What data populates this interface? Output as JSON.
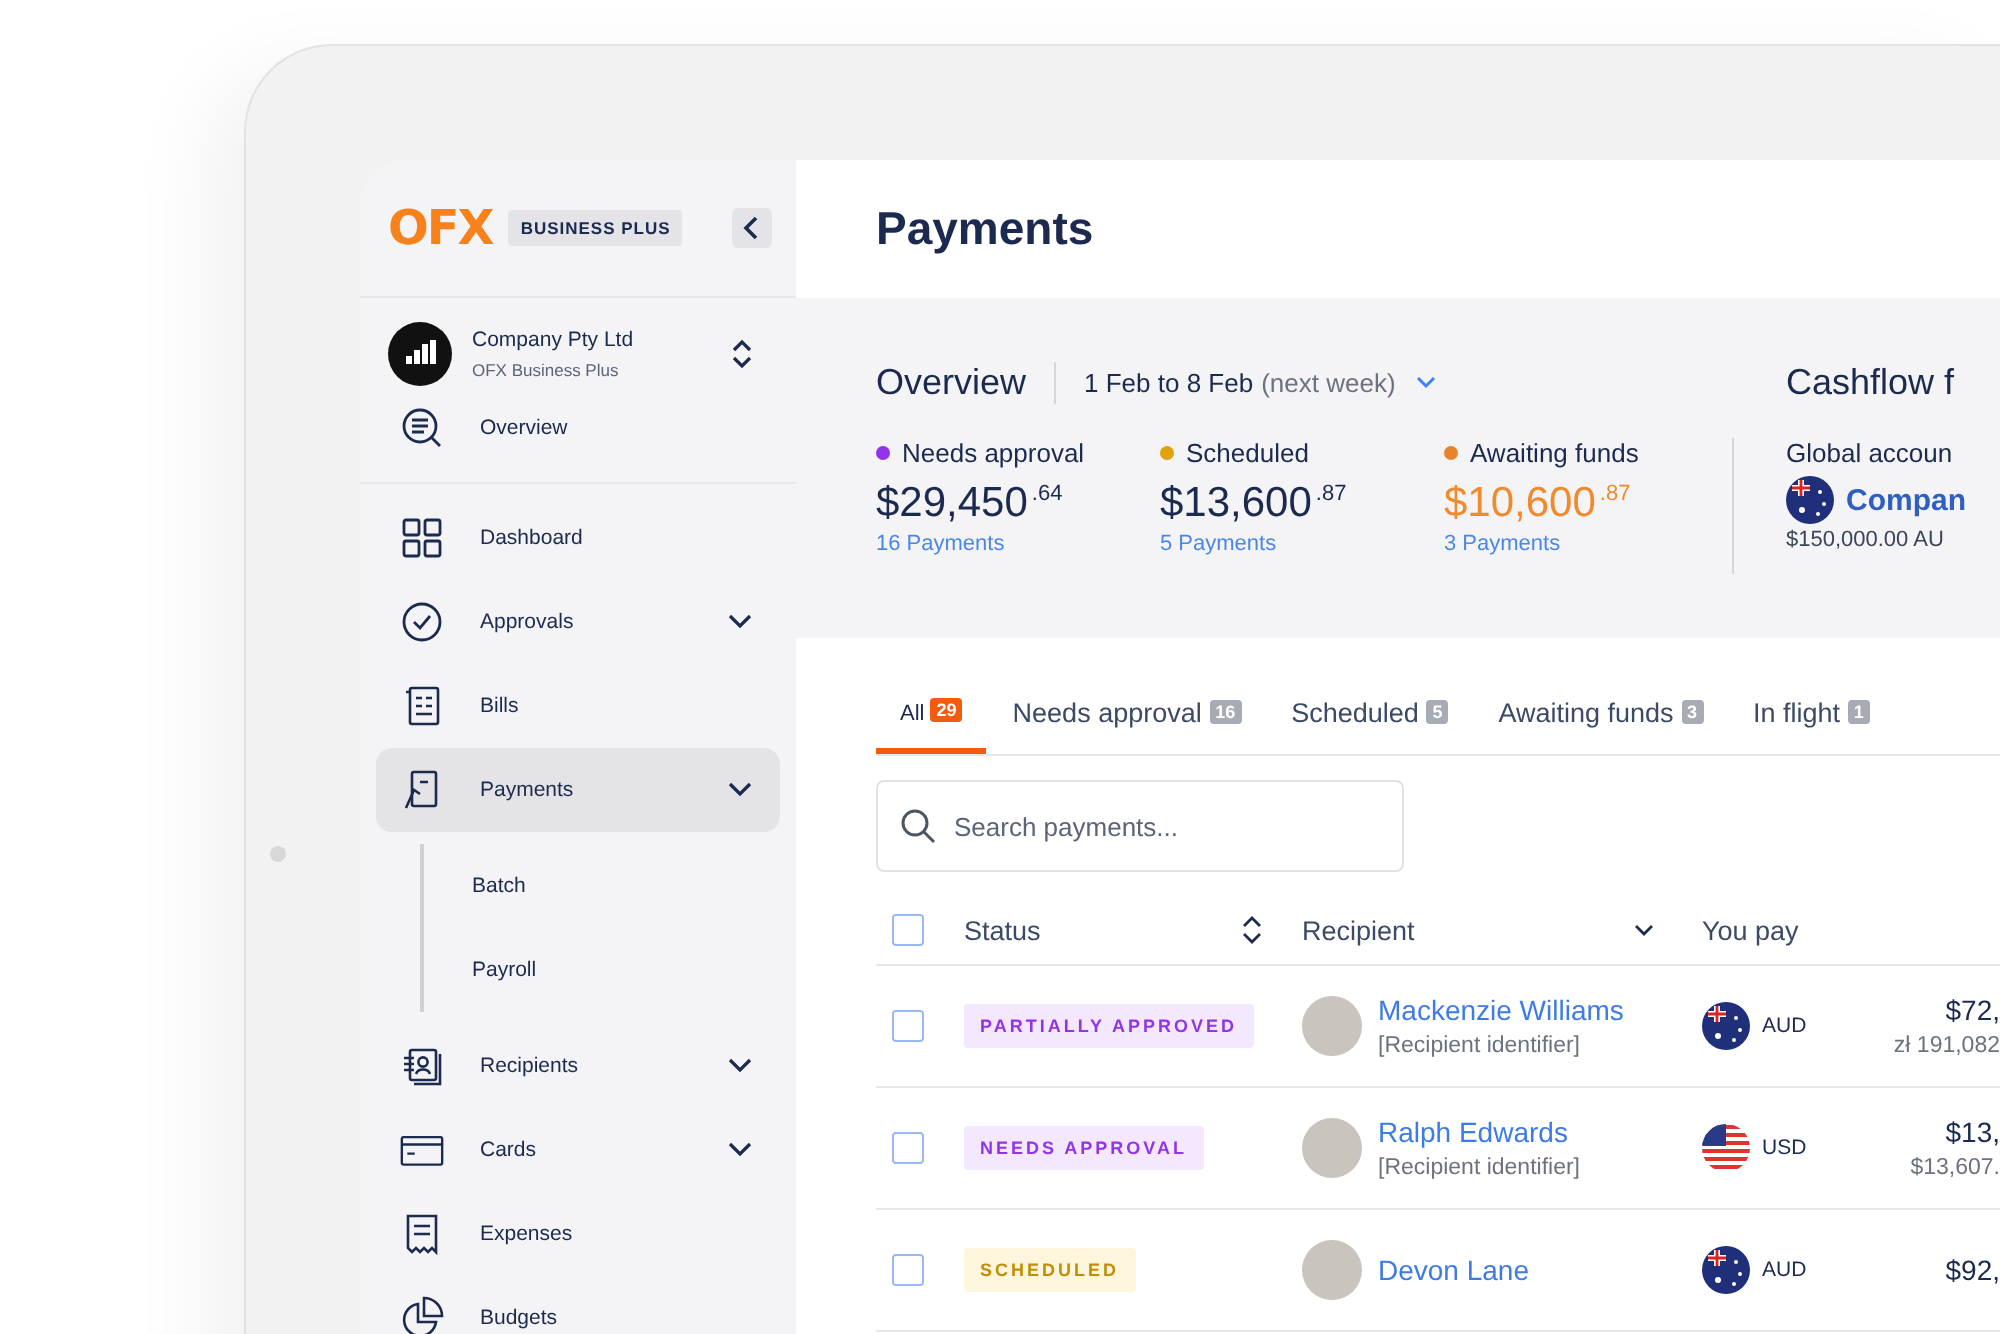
{
  "brand": {
    "logo": "OFX",
    "plan_badge": "BUSINESS PLUS"
  },
  "account": {
    "name": "Company Pty Ltd",
    "plan": "OFX Business Plus"
  },
  "sidebar": {
    "top_items": [
      {
        "label": "Overview",
        "kind": "overview",
        "selected": false
      }
    ],
    "items": [
      {
        "label": "Dashboard",
        "kind": "dashboard",
        "selected": false,
        "has_submenu": false
      },
      {
        "label": "Approvals",
        "kind": "approvals",
        "selected": false,
        "has_submenu": true
      },
      {
        "label": "Bills",
        "kind": "bills",
        "selected": false,
        "has_submenu": false
      },
      {
        "label": "Payments",
        "kind": "payments",
        "selected": true,
        "has_submenu": true,
        "children": [
          {
            "label": "Batch",
            "selected": false
          },
          {
            "label": "Payroll",
            "selected": false
          }
        ]
      },
      {
        "label": "Recipients",
        "kind": "recipients",
        "selected": false,
        "has_submenu": true
      },
      {
        "label": "Cards",
        "kind": "cards",
        "selected": false,
        "has_submenu": true
      },
      {
        "label": "Expenses",
        "kind": "expenses",
        "selected": false,
        "has_submenu": false
      },
      {
        "label": "Budgets",
        "kind": "budgets",
        "selected": false,
        "has_submenu": false
      }
    ]
  },
  "page_title": "Payments",
  "overview": {
    "title": "Overview",
    "period": "1 Feb to 8 Feb",
    "period_note": "(next week)",
    "stats": [
      {
        "label": "Needs approval",
        "color": "#9333ea",
        "amount": "$29,450",
        "cents": ".64",
        "count": "16 Payments",
        "highlight": false
      },
      {
        "label": "Scheduled",
        "color": "#e0a30b",
        "amount": "$13,600",
        "cents": ".87",
        "count": "5 Payments",
        "highlight": false
      },
      {
        "label": "Awaiting funds",
        "color": "#e8832a",
        "amount": "$10,600",
        "cents": ".87",
        "count": "3 Payments",
        "highlight": true
      }
    ]
  },
  "cashflow": {
    "title": "Cashflow f",
    "account_label": "Global accoun",
    "account_name": "Compan",
    "balance": "$150,000.00 AU"
  },
  "tabs": [
    {
      "label": "All",
      "count": "29",
      "selected": true
    },
    {
      "label": "Needs approval",
      "count": "16",
      "selected": false
    },
    {
      "label": "Scheduled",
      "count": "5",
      "selected": false
    },
    {
      "label": "Awaiting funds",
      "count": "3",
      "selected": false
    },
    {
      "label": "In flight",
      "count": "1",
      "selected": false
    }
  ],
  "search": {
    "placeholder": "Search payments..."
  },
  "table": {
    "select_all_checked": false,
    "columns": [
      {
        "label": "Status",
        "kind": "sortable"
      },
      {
        "label": "Recipient",
        "kind": "dropdown"
      },
      {
        "label": "You pay",
        "kind": "plain"
      }
    ],
    "rows": [
      {
        "checked": false,
        "status": {
          "label": "PARTIALLY APPROVED",
          "kind": "approval"
        },
        "name": "Mackenzie Williams",
        "identifier": "[Recipient identifier]",
        "pay": {
          "kind": "au",
          "currency": "AUD"
        },
        "amount": "$72,",
        "converted": "zł 191,082"
      },
      {
        "checked": false,
        "status": {
          "label": "NEEDS APPROVAL",
          "kind": "approval"
        },
        "name": "Ralph Edwards",
        "identifier": "[Recipient identifier]",
        "pay": {
          "kind": "us",
          "currency": "USD"
        },
        "amount": "$13,",
        "converted": "$13,607."
      },
      {
        "checked": false,
        "status": {
          "label": "SCHEDULED",
          "kind": "scheduled"
        },
        "name": "Devon Lane",
        "pay": {
          "kind": "au",
          "currency": "AUD"
        },
        "amount": "$92,"
      }
    ]
  }
}
